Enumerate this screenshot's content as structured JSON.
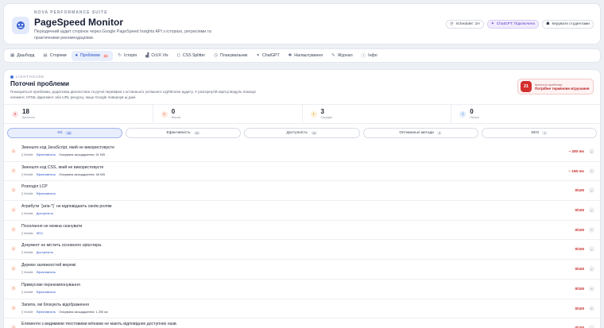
{
  "header": {
    "brand": "NOVA PERFORMANCE SUITE",
    "title": "PageSpeed Monitor",
    "subtitle": "Періодичний аудит сторінок через Google PageSpeed Insights API з історією, регресіями та практичними рекомендаціями.",
    "scheduler_label": "Scheduler: 1H",
    "chatgpt_label": "ChatGPT: Підключено",
    "users_label": "Керувати студентами"
  },
  "nav": {
    "tabs": [
      {
        "label": "Дашборд",
        "icon": "dashboard-icon"
      },
      {
        "label": "Сторінки",
        "icon": "pages-icon"
      },
      {
        "label": "Проблеми",
        "icon": "issues-icon",
        "badge": "21",
        "active": true
      },
      {
        "label": "Історія",
        "icon": "history-icon"
      },
      {
        "label": "CrUX Vis",
        "icon": "chart-icon"
      },
      {
        "label": "CSS Splitter",
        "icon": "code-icon"
      },
      {
        "label": "Планувальник",
        "icon": "clock-icon"
      },
      {
        "label": "ChatGPT",
        "icon": "spark-icon"
      },
      {
        "label": "Налаштування",
        "icon": "gear-icon"
      },
      {
        "label": "Журнал",
        "icon": "log-icon"
      },
      {
        "label": "Інфо",
        "icon": "info-icon"
      }
    ]
  },
  "panel": {
    "kicker": "LIGHTHOUSE",
    "title": "Поточні проблеми",
    "description": "Показуються проблеми, додаткова діагностика та ручні перевірки з останнього успішного Lighthouse аудиту. У розгорнутій картці модуль показує елемент, HTML-фрагмент або URL ресурсу, якщо Google повернув ці дані.",
    "critical": {
      "count": "21",
      "label1": "Критичні проблеми",
      "label2": "Потрібне термінове втручання"
    }
  },
  "stats": [
    {
      "value": "18",
      "label": "Критичні",
      "icon": "×",
      "color": "#d32f2f",
      "bg": "#fde3e3"
    },
    {
      "value": "0",
      "label": "Високі",
      "icon": "!",
      "color": "#e8591a",
      "bg": "#fde7dc"
    },
    {
      "value": "3",
      "label": "Середні",
      "icon": "!",
      "color": "#e39a0b",
      "bg": "#fdf0d6"
    },
    {
      "value": "0",
      "label": "Низькі",
      "icon": "i",
      "color": "#2f7ad9",
      "bg": "#e0ecfb"
    }
  ],
  "filters": [
    {
      "label": "Усі",
      "count": "40",
      "active": true
    },
    {
      "label": "Ефективність",
      "count": "22"
    },
    {
      "label": "Доступність",
      "count": "10"
    },
    {
      "label": "Оптимальні методи",
      "count": "3"
    },
    {
      "label": "SEO",
      "count": "2"
    }
  ],
  "issues": [
    {
      "title": "Зменште код JavaScript, який не використовуєте",
      "device": "Mobile",
      "category": "Ефективність",
      "savings": "Очікувана заощадження: 51 KiB",
      "value": "~ 200 ms"
    },
    {
      "title": "Зменште код CSS, який не використовуєте",
      "device": "Mobile",
      "category": "Ефективність",
      "savings": "Очікувана заощадження: 48 KiB",
      "value": "~ 150 ms"
    },
    {
      "title": "Розподіл LCP",
      "device": "Mobile",
      "category": "Ефективність",
      "savings": "",
      "value": "0/100"
    },
    {
      "title": "Атрибути `[aria-*]` не відповідають своїм ролям",
      "device": "Mobile",
      "category": "Доступність",
      "savings": "",
      "value": "0/100"
    },
    {
      "title": "Посилання не можна сканувати",
      "device": "Mobile",
      "category": "SEO",
      "savings": "",
      "value": "0/100"
    },
    {
      "title": "Документ не містить основного орієнтира.",
      "device": "Mobile",
      "category": "Доступність",
      "savings": "",
      "value": "0/100"
    },
    {
      "title": "Дерево залежностей мережі",
      "device": "Mobile",
      "category": "Ефективність",
      "savings": "",
      "value": "0/100"
    },
    {
      "title": "Примусове перекомпонування",
      "device": "Mobile",
      "category": "Ефективність",
      "savings": "",
      "value": "0/100"
    },
    {
      "title": "Запити, які блокують відображення",
      "device": "Mobile",
      "category": "Ефективність",
      "savings": "Очікувана заощадження: 1 250 мс",
      "value": "0/100"
    },
    {
      "title": "Елементи з видимими текстовими мітками не мають відповідних доступних назв.",
      "device": "Mobile",
      "category": "Доступність",
      "savings": "",
      "value": "0/100"
    }
  ]
}
